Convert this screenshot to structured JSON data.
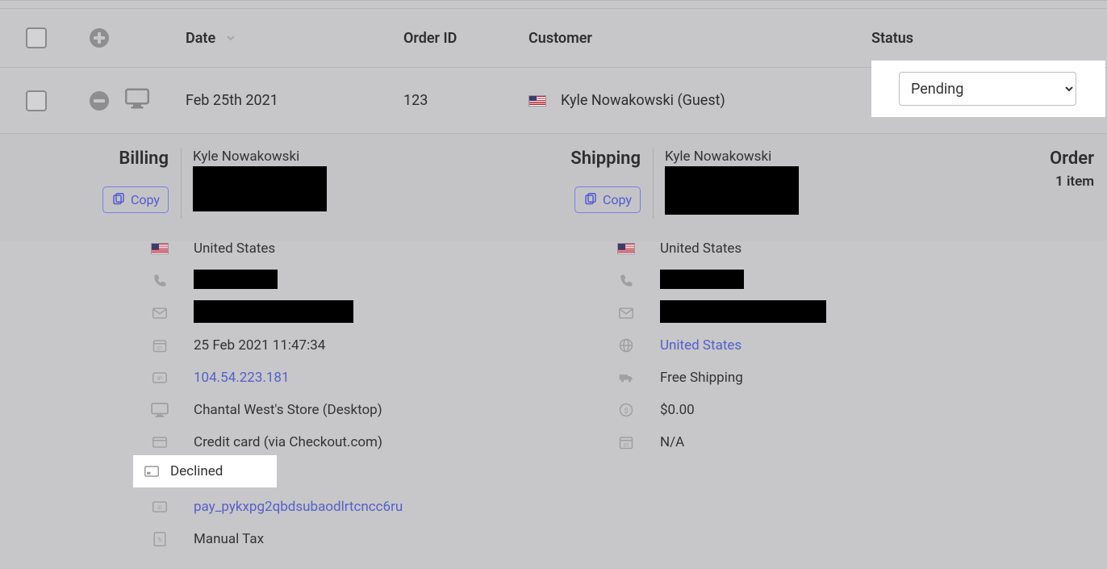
{
  "headers": {
    "date": "Date",
    "order_id": "Order ID",
    "customer": "Customer",
    "status": "Status"
  },
  "row": {
    "date": "Feb 25th 2021",
    "order_id": "123",
    "customer": "Kyle Nowakowski (Guest)",
    "status_options": [
      "Pending"
    ],
    "status_selected": "Pending"
  },
  "billing": {
    "title": "Billing",
    "copy": "Copy",
    "name": "Kyle Nowakowski",
    "country": "United States",
    "datetime": "25 Feb 2021 11:47:34",
    "ip": "104.54.223.181",
    "store": "Chantal West's Store (Desktop)",
    "payment_method": "Credit card (via Checkout.com)",
    "payment_status": "Declined",
    "payment_id": "pay_pykxpg2qbdsubaodlrtcncc6ru",
    "tax": "Manual Tax"
  },
  "shipping": {
    "title": "Shipping",
    "copy": "Copy",
    "name": "Kyle Nowakowski",
    "country": "United States",
    "region_link": "United States",
    "method": "Free Shipping",
    "cost": "$0.00",
    "ship_date": "N/A"
  },
  "order": {
    "title": "Order",
    "item_count": "1 item"
  }
}
